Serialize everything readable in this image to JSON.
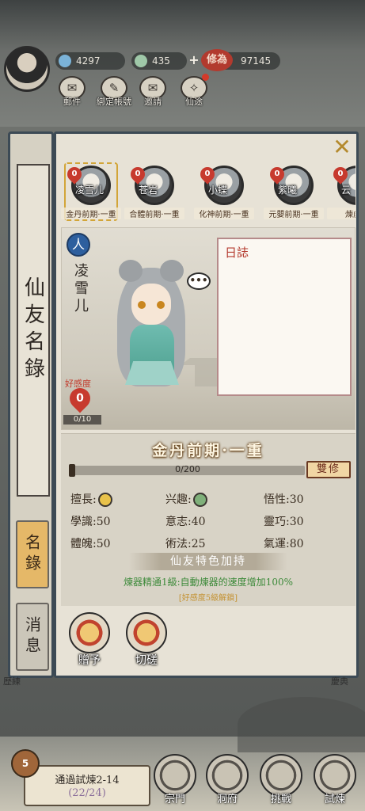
{
  "hud": {
    "resources": [
      {
        "name": "spirit-stone",
        "value": "4297",
        "color": "#7bb3d8"
      },
      {
        "name": "jade",
        "value": "435",
        "color": "#9fc8a8"
      },
      {
        "name": "cultivation",
        "value": "97145",
        "color": "#b23a2e"
      }
    ],
    "qi_badge": "修為",
    "plus": "+",
    "buttons": [
      {
        "label": "郵件",
        "icon": "mail-icon"
      },
      {
        "label": "綁定帳號",
        "icon": "link-icon"
      },
      {
        "label": "邀請",
        "icon": "invite-icon"
      },
      {
        "label": "仙途",
        "icon": "path-icon"
      }
    ]
  },
  "side": {
    "title": "仙友名錄",
    "tabs": [
      {
        "label": "名錄",
        "active": true
      },
      {
        "label": "消息",
        "active": false
      }
    ]
  },
  "dialog": {
    "close": "✕",
    "friends": [
      {
        "name": "凌雪儿",
        "realm": "金丹前期·一重",
        "favor": "0",
        "selected": true
      },
      {
        "name": "苍岩",
        "realm": "合體前期·一重",
        "favor": "0",
        "selected": false
      },
      {
        "name": "小蝶",
        "realm": "化神前期·一重",
        "favor": "0",
        "selected": false
      },
      {
        "name": "紫曦",
        "realm": "元嬰前期·一重",
        "favor": "0",
        "selected": false
      },
      {
        "name": "云",
        "realm": "煉虛前",
        "favor": "0",
        "selected": false
      }
    ],
    "character": {
      "type_badge": "人",
      "name": "凌雪儿",
      "speech": "•••",
      "favor_label": "好感度",
      "favor_value": "0",
      "favor_progress": "0/10",
      "favor_fraction": 0
    },
    "diary": {
      "title": "日誌"
    },
    "info": {
      "realm": "金丹前期·一重",
      "progress_text": "0/200",
      "progress_fraction": 0,
      "dual_button": "雙修",
      "stats": [
        {
          "label": "擅長:",
          "value": "",
          "icon": "specialty-icon",
          "col": 0,
          "row": 0
        },
        {
          "label": "兴趣:",
          "value": "",
          "icon": "interest-icon",
          "col": 1,
          "row": 0
        },
        {
          "label": "悟性:",
          "value": "30",
          "icon": "",
          "col": 2,
          "row": 0
        },
        {
          "label": "學識:",
          "value": "50",
          "icon": "",
          "col": 0,
          "row": 1
        },
        {
          "label": "意志:",
          "value": "40",
          "icon": "",
          "col": 1,
          "row": 1
        },
        {
          "label": "靈巧:",
          "value": "30",
          "icon": "",
          "col": 2,
          "row": 1
        },
        {
          "label": "體魄:",
          "value": "50",
          "icon": "",
          "col": 0,
          "row": 2
        },
        {
          "label": "術法:",
          "value": "25",
          "icon": "",
          "col": 1,
          "row": 2
        },
        {
          "label": "氣運:",
          "value": "80",
          "icon": "",
          "col": 2,
          "row": 2
        }
      ],
      "feature_head": "仙友特色加持",
      "feature_text": "煉器精通1級:自動煉器的速度增加100%",
      "feature_lock": "[好感度5級解鎖]"
    },
    "actions": [
      {
        "label": "贈予",
        "icon": "gift-icon"
      },
      {
        "label": "切磋",
        "icon": "spar-icon"
      }
    ]
  },
  "bottom": {
    "quest_title": "通過試煉2-14",
    "quest_progress": "(22/24)",
    "quest_level": "5",
    "nav": [
      {
        "label": "宗門",
        "icon": "sect-icon"
      },
      {
        "label": "洞府",
        "icon": "cave-icon"
      },
      {
        "label": "挑戰",
        "icon": "challenge-icon"
      },
      {
        "label": "試煉",
        "icon": "trial-icon"
      }
    ],
    "corner_left": "歷練",
    "corner_right": "慶典"
  }
}
